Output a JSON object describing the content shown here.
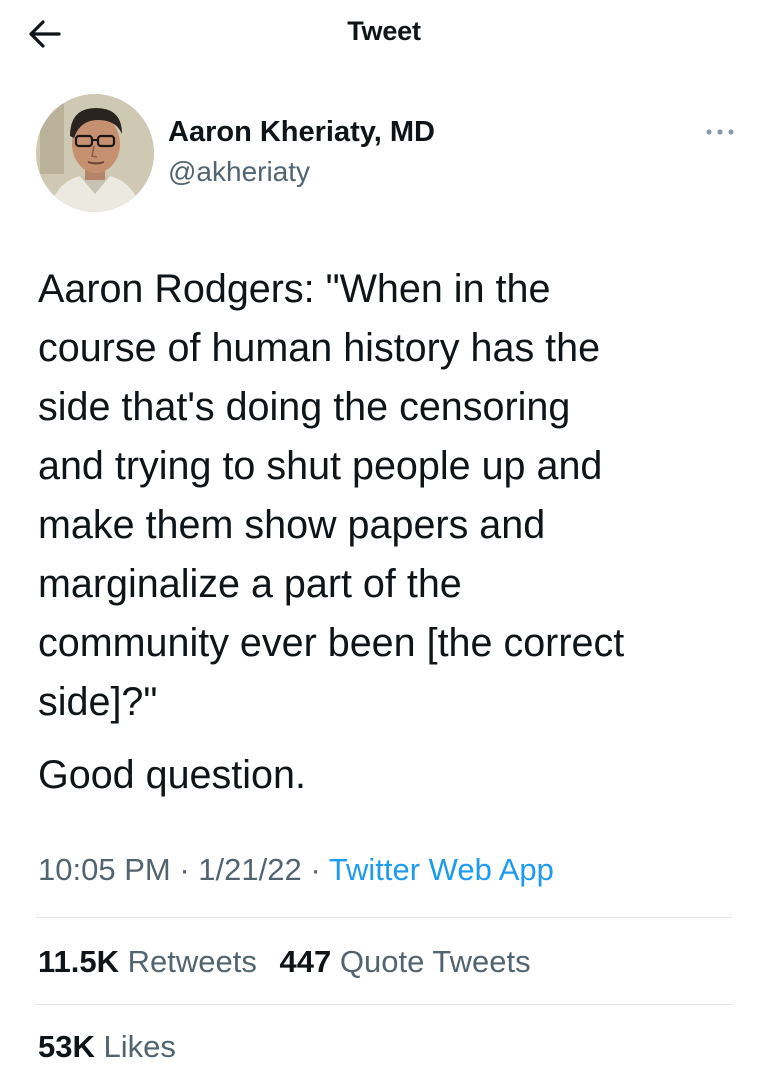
{
  "header": {
    "title": "Tweet",
    "back_icon": "arrow-left-icon"
  },
  "author": {
    "name": "Aaron Kheriaty, MD",
    "handle": "@akheriaty",
    "more_icon": "more-horizontal-icon"
  },
  "tweet": {
    "text_paragraph_1": "Aaron Rodgers: \"When in the\ncourse of human history has the\nside that's doing the censoring\nand trying to shut people up and\nmake them show papers and\nmarginalize a part of the\ncommunity ever been [the correct\nside]?\"",
    "text_paragraph_2": "Good question.",
    "time": "10:05 PM",
    "separator": "·",
    "date": "1/21/22",
    "source": "Twitter Web App"
  },
  "stats": {
    "retweets_count": "11.5K",
    "retweets_label": "Retweets",
    "quote_count": "447",
    "quote_label": "Quote Tweets",
    "likes_count": "53K",
    "likes_label": "Likes"
  },
  "colors": {
    "text": "#0f1419",
    "secondary": "#536471",
    "link": "#1d9bf0",
    "divider": "#e1e6ea"
  }
}
